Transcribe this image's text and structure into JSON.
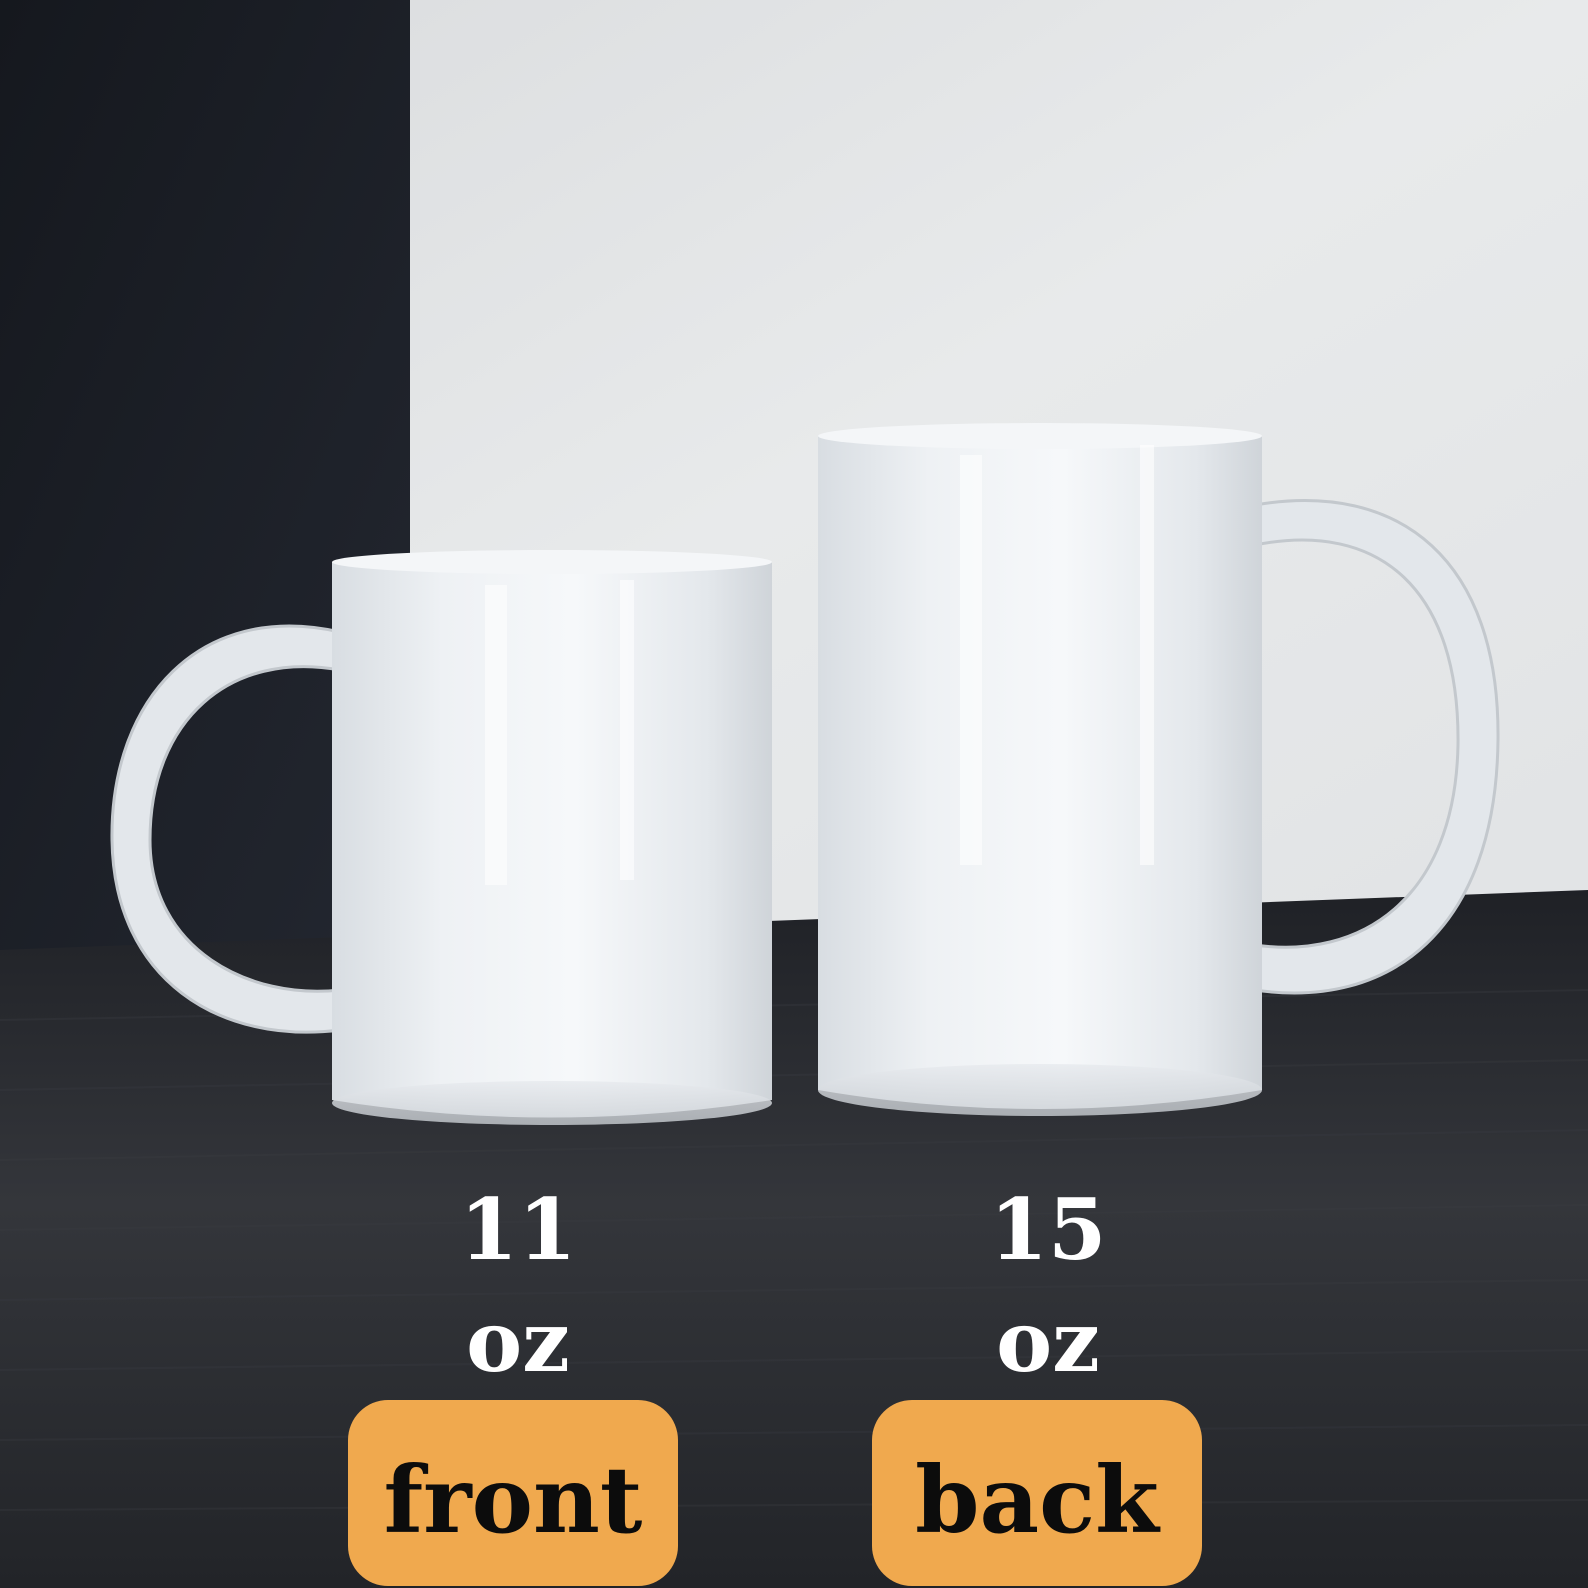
{
  "mugs": {
    "small": {
      "size": "11",
      "unit": "oz"
    },
    "large": {
      "size": "15",
      "unit": "oz"
    }
  },
  "buttons": {
    "front": "front",
    "back": "back"
  },
  "colors": {
    "button_fill": "#f0a94e",
    "button_text": "#0c0c0c",
    "label_text": "#ffffff",
    "mug_white": "#eef1f4",
    "wall_dark": "#1a1d24",
    "wall_light": "#e6e8ea",
    "table": "#2a2c31"
  }
}
